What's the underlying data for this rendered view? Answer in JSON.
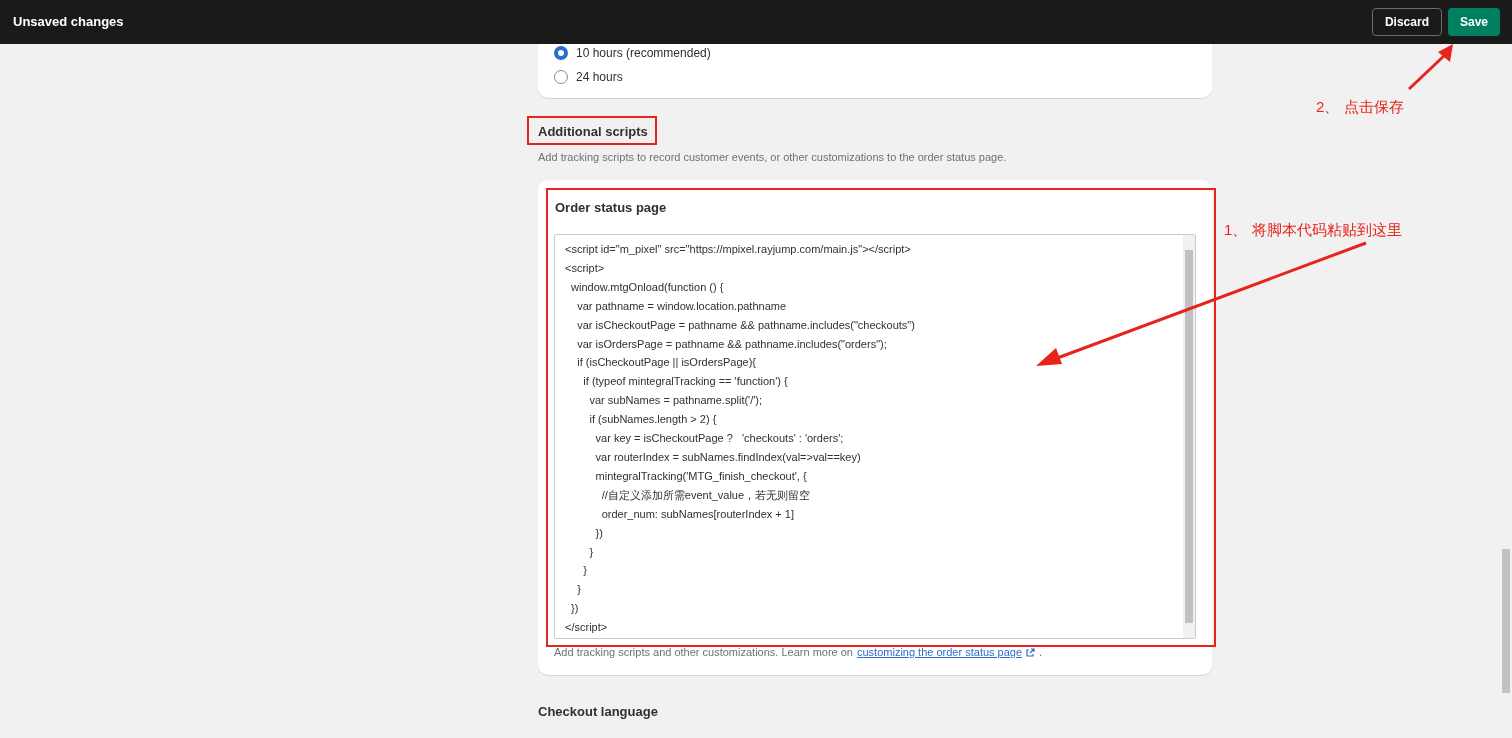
{
  "top_bar": {
    "title": "Unsaved changes",
    "buttons": [
      {
        "label": "Discard",
        "kind": "secondary"
      },
      {
        "label": "Save",
        "kind": "primary"
      }
    ]
  },
  "timeout_card": {
    "options": [
      {
        "label": "10 hours (recommended)",
        "selected": true
      },
      {
        "label": "24 hours",
        "selected": false
      }
    ]
  },
  "additional_scripts": {
    "heading": "Additional scripts",
    "description": "Add tracking scripts to record customer events, or other customizations to the order status page.",
    "order_status_page": {
      "title": "Order status page",
      "code_lines": [
        "<script id=\"m_pixel\" src=\"https://mpixel.rayjump.com/main.js\"></script>",
        "<script>",
        "  window.mtgOnload(function () {",
        "    var pathname = window.location.pathname",
        "    var isCheckoutPage = pathname && pathname.includes(\"checkouts\")",
        "    var isOrdersPage = pathname && pathname.includes(\"orders\");",
        "    if (isCheckoutPage || isOrdersPage){",
        "      if (typeof mintegralTracking == 'function') {",
        "        var subNames = pathname.split('/');",
        "        if (subNames.length > 2) {",
        "          var key = isCheckoutPage ?   'checkouts' : 'orders';",
        "          var routerIndex = subNames.findIndex(val=>val==key)",
        "          mintegralTracking('MTG_finish_checkout', {",
        "            //自定义添加所需event_value，若无则留空",
        "            order_num: subNames[routerIndex + 1]",
        "          })",
        "        }",
        "      }",
        "    }",
        "  })",
        "</script>"
      ],
      "help_text": "Add tracking scripts and other customizations. Learn more on",
      "help_link": "customizing the order status page",
      "help_end": "."
    }
  },
  "checkout_language": {
    "heading": "Checkout language"
  },
  "annotations": [
    {
      "text": "2、 点击保存"
    },
    {
      "text": "1、 将脚本代码粘贴到这里"
    }
  ]
}
